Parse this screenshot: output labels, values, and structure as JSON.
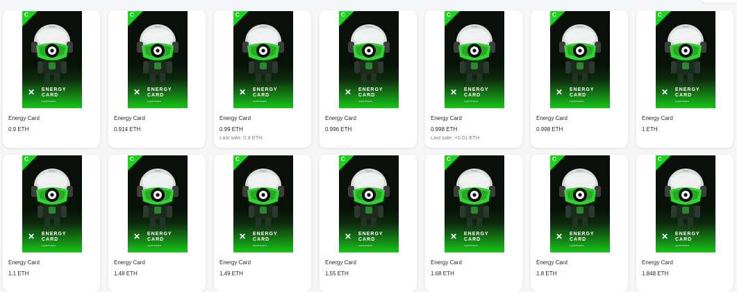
{
  "collection": {
    "card_art": {
      "badge_icon": "brand-c-icon",
      "badge_glyph": "C",
      "logo_glyph": "✕",
      "logo_text": "ENERGY\nCARD",
      "logo_subtext": "Avarik Projects",
      "accent_color": "#22d022"
    },
    "items": [
      {
        "name": "Energy Card",
        "price": "0.9 ETH",
        "last_sale": ""
      },
      {
        "name": "Energy Card",
        "price": "0.914 ETH",
        "last_sale": ""
      },
      {
        "name": "Energy Card",
        "price": "0.99 ETH",
        "last_sale": "Last sale: 0.9 ETH"
      },
      {
        "name": "Energy Card",
        "price": "0.996 ETH",
        "last_sale": ""
      },
      {
        "name": "Energy Card",
        "price": "0.998 ETH",
        "last_sale": "Last sale: <0.01 ETH"
      },
      {
        "name": "Energy Card",
        "price": "0.998 ETH",
        "last_sale": ""
      },
      {
        "name": "Energy Card",
        "price": "1 ETH",
        "last_sale": ""
      },
      {
        "name": "Energy Card",
        "price": "1.1 ETH",
        "last_sale": ""
      },
      {
        "name": "Energy Card",
        "price": "1.48 ETH",
        "last_sale": ""
      },
      {
        "name": "Energy Card",
        "price": "1.49 ETH",
        "last_sale": ""
      },
      {
        "name": "Energy Card",
        "price": "1.55 ETH",
        "last_sale": ""
      },
      {
        "name": "Energy Card",
        "price": "1.68 ETH",
        "last_sale": ""
      },
      {
        "name": "Energy Card",
        "price": "1.8 ETH",
        "last_sale": ""
      },
      {
        "name": "Energy Card",
        "price": "1.848 ETH",
        "last_sale": ""
      }
    ]
  }
}
